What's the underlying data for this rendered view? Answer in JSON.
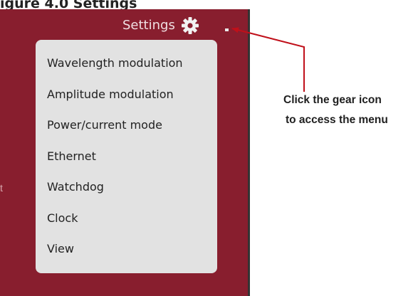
{
  "doc": {
    "top_cut_text": "igure 4.0 Settings"
  },
  "app": {
    "panel_color": "#881e2e",
    "left_glyph": "t",
    "settings": {
      "label": "Settings",
      "icon": "gear-icon"
    },
    "menu": {
      "items": [
        {
          "label": "Wavelength modulation"
        },
        {
          "label": "Amplitude modulation"
        },
        {
          "label": "Power/current mode"
        },
        {
          "label": "Ethernet"
        },
        {
          "label": "Watchdog"
        },
        {
          "label": "Clock"
        },
        {
          "label": "View"
        }
      ]
    }
  },
  "callout": {
    "line1": "Click the gear icon",
    "line2": "to access the menu",
    "arrow_color": "#c0101a"
  }
}
